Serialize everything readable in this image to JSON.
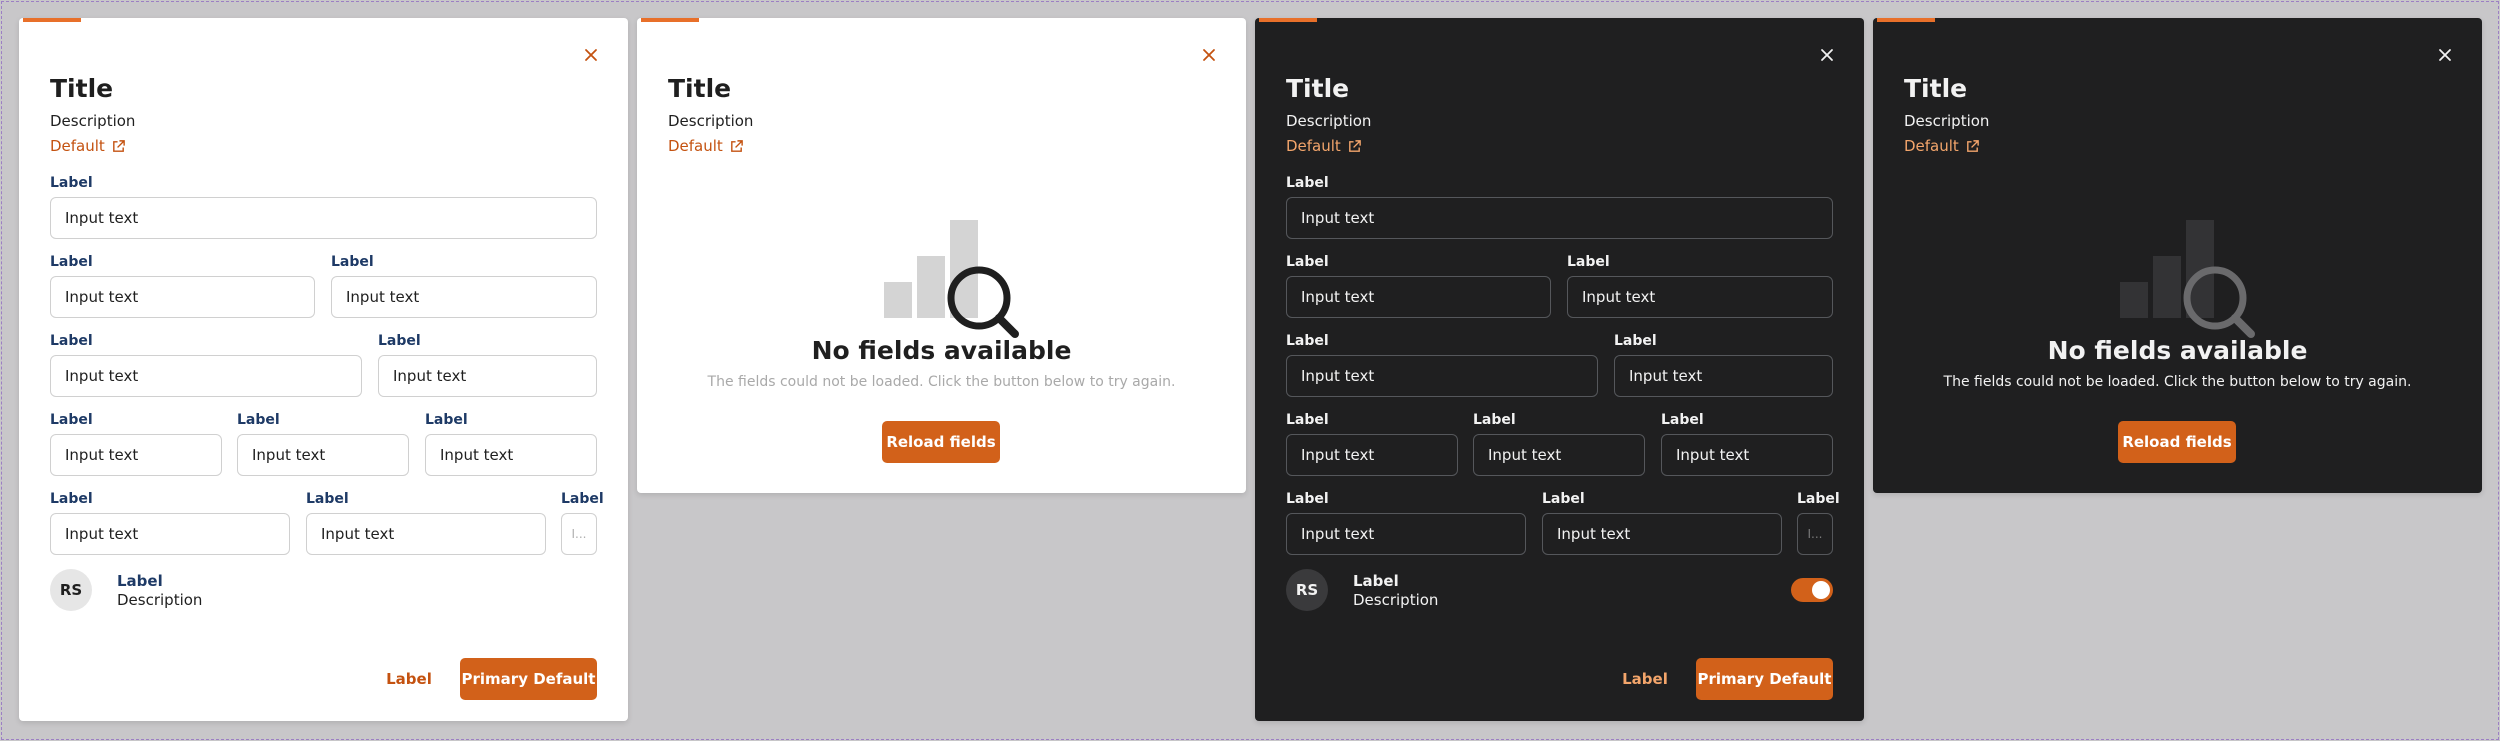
{
  "colors": {
    "accent": "#e8702a",
    "primary_button": "#d2611a",
    "light_link": "#c45210",
    "dark_link": "#f3a56b",
    "light_label": "#1e3a66",
    "dark_panel": "#1f1f20",
    "canvas_bg": "#c8c7c9"
  },
  "form_light": {
    "title": "Title",
    "description": "Description",
    "link": "Default",
    "rows": [
      [
        {
          "label": "Label",
          "value": "Input text"
        }
      ],
      [
        {
          "label": "Label",
          "value": "Input text"
        },
        {
          "label": "Label",
          "value": "Input text"
        }
      ],
      [
        {
          "label": "Label",
          "value": "Input text"
        },
        {
          "label": "Label",
          "value": "Input text"
        }
      ],
      [
        {
          "label": "Label",
          "value": "Input text"
        },
        {
          "label": "Label",
          "value": "Input text"
        },
        {
          "label": "Label",
          "value": "Input text"
        }
      ],
      [
        {
          "label": "Label",
          "value": "Input text"
        },
        {
          "label": "Label",
          "value": "Input text"
        },
        {
          "label": "Label",
          "value": "I..."
        }
      ]
    ],
    "person": {
      "initials": "RS",
      "label": "Label",
      "description": "Description"
    },
    "footer": {
      "secondary": "Label",
      "primary": "Primary Default"
    }
  },
  "empty_light": {
    "title": "Title",
    "description": "Description",
    "link": "Default",
    "empty_title": "No fields available",
    "empty_desc": "The fields could not be loaded. Click the button below to try again.",
    "reload": "Reload fields"
  },
  "form_dark": {
    "title": "Title",
    "description": "Description",
    "link": "Default",
    "rows": [
      [
        {
          "label": "Label",
          "value": "Input text"
        }
      ],
      [
        {
          "label": "Label",
          "value": "Input text"
        },
        {
          "label": "Label",
          "value": "Input text"
        }
      ],
      [
        {
          "label": "Label",
          "value": "Input text"
        },
        {
          "label": "Label",
          "value": "Input text"
        }
      ],
      [
        {
          "label": "Label",
          "value": "Input text"
        },
        {
          "label": "Label",
          "value": "Input text"
        },
        {
          "label": "Label",
          "value": "Input text"
        }
      ],
      [
        {
          "label": "Label",
          "value": "Input text"
        },
        {
          "label": "Label",
          "value": "Input text"
        },
        {
          "label": "Label",
          "value": "I..."
        }
      ]
    ],
    "person": {
      "initials": "RS",
      "label": "Label",
      "description": "Description",
      "toggle_on": true
    },
    "footer": {
      "secondary": "Label",
      "primary": "Primary Default"
    }
  },
  "empty_dark": {
    "title": "Title",
    "description": "Description",
    "link": "Default",
    "empty_title": "No fields available",
    "empty_desc": "The fields could not be loaded. Click the button below to try again.",
    "reload": "Reload fields"
  }
}
